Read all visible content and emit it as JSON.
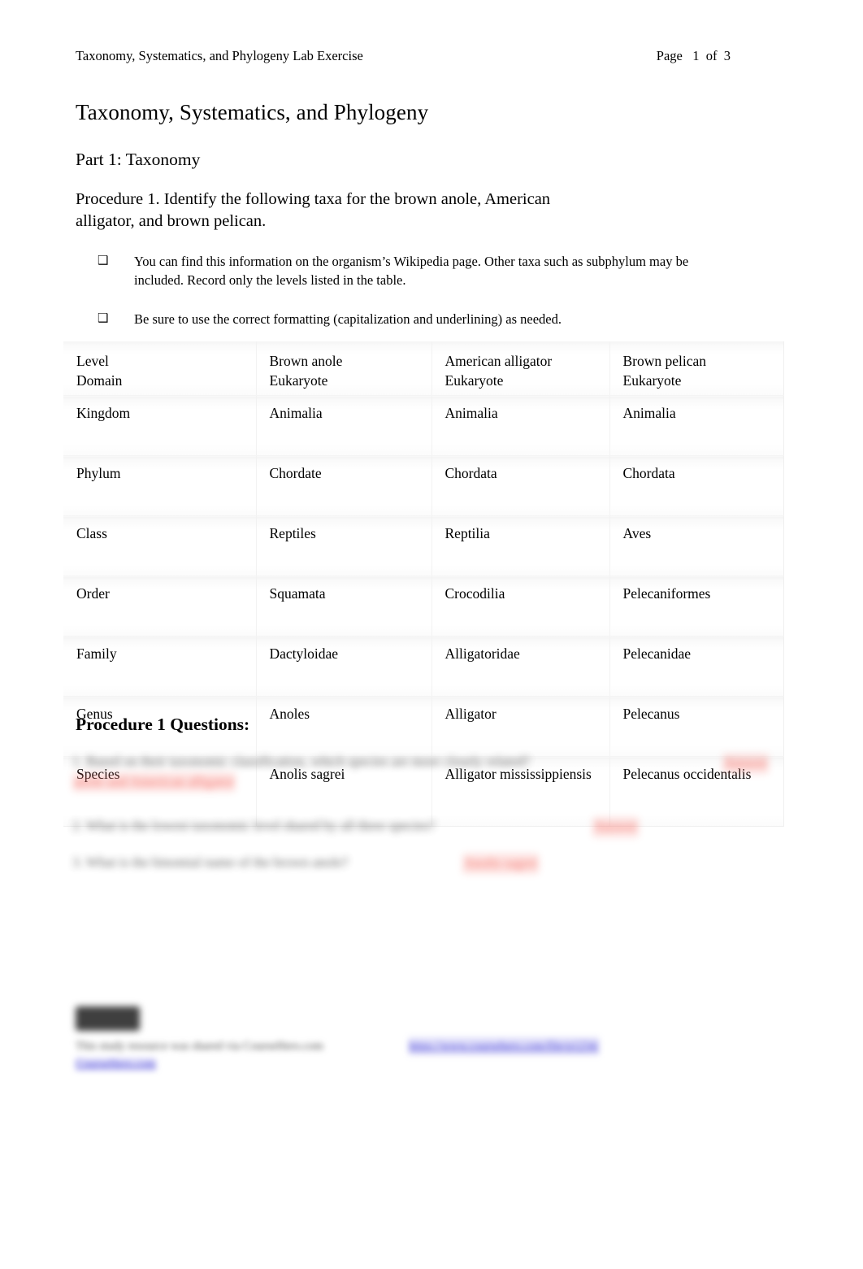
{
  "header": {
    "doc_title_running": "Taxonomy, Systematics, and Phylogeny Lab Exercise",
    "page_indicator": "Page   1  of  3"
  },
  "title": "Taxonomy, Systematics, and Phylogeny",
  "part_title": "Part 1: Taxonomy",
  "procedure_intro": "Procedure 1. Identify the following taxa for the brown anole, American alligator, and brown pelican.",
  "bullets": [
    {
      "glyph": "❑",
      "text": "You can find this information on the organism’s Wikipedia page. Other taxa such as subphylum may be included. Record only the levels listed in the table."
    },
    {
      "glyph": "❑",
      "text": "Be sure to use the correct formatting (capitalization and underlining) as needed."
    }
  ],
  "table": {
    "columns": [
      "Level",
      "Brown anole",
      "American alligator",
      "Brown pelican"
    ],
    "first_row_label": "Domain",
    "first_row_values": [
      "Eukaryote",
      "Eukaryote",
      "Eukaryote"
    ],
    "rows": [
      {
        "level": "Kingdom",
        "brown_anole": "Animalia",
        "american_alligator": "Animalia",
        "brown_pelican": "Animalia"
      },
      {
        "level": "Phylum",
        "brown_anole": "Chordate",
        "american_alligator": "Chordata",
        "brown_pelican": "Chordata"
      },
      {
        "level": "Class",
        "brown_anole": "Reptiles",
        "american_alligator": "Reptilia",
        "brown_pelican": "Aves"
      },
      {
        "level": "Order",
        "brown_anole": "Squamata",
        "american_alligator": "Crocodilia",
        "brown_pelican": "Pelecaniformes"
      },
      {
        "level": "Family",
        "brown_anole": "Dactyloidae",
        "american_alligator": "Alligatoridae",
        "brown_pelican": "Pelecanidae"
      },
      {
        "level": "Genus",
        "brown_anole": "Anoles",
        "american_alligator": "Alligator",
        "brown_pelican": "Pelecanus"
      },
      {
        "level": "Species",
        "brown_anole": "Anolis sagrei",
        "american_alligator": "Alligator mississippiensis",
        "brown_pelican": "Pelecanus occidentalis"
      }
    ]
  },
  "questions_heading": "Procedure 1 Questions:",
  "questions": [
    {
      "prompt": "1. Based on their taxonomic classification, which species are more closely related?",
      "answer_inline": "anole and American alligator",
      "answer_right": "Answer"
    },
    {
      "prompt": "2. What is the lowest taxonomic level shared by all three species?",
      "answer_right": "Answer"
    },
    {
      "prompt": "3. What is the binomial name of the brown anole?",
      "answer_right": "Anolis sagrei"
    }
  ],
  "footer": {
    "badge": "Answer",
    "line_text": "This study resource was shared via CourseHero.com",
    "link_left": "CourseHero.com",
    "link_right": "https://www.coursehero.com/file/p1234/"
  },
  "colors": {
    "answer_red": "#f2584f",
    "link_blue": "#4b46d8",
    "badge_dark": "#3f3f3f",
    "page_background": "#ffffff",
    "text": "#000000"
  }
}
